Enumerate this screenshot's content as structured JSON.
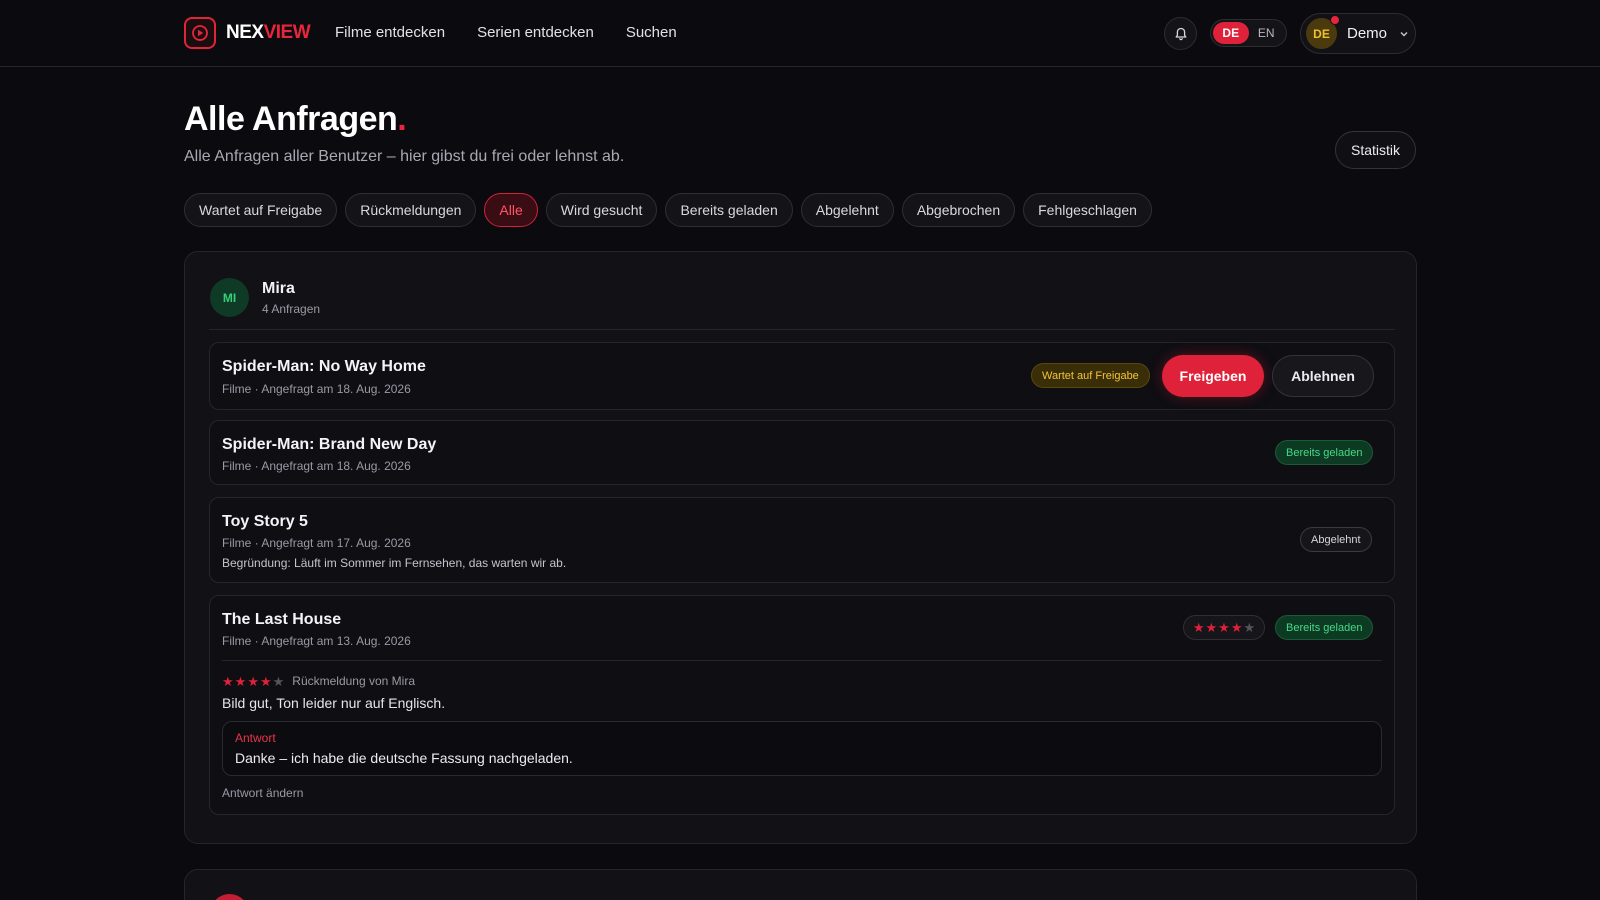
{
  "header": {
    "logo_a": "NEX",
    "logo_b": "VIEW",
    "nav": [
      "Filme entdecken",
      "Serien entdecken",
      "Suchen"
    ],
    "lang_active": "DE",
    "lang_other": "EN",
    "user_initials": "DE",
    "user_name": "Demo"
  },
  "page": {
    "title": "Alle Anfragen",
    "title_dot": ".",
    "subtitle": "Alle Anfragen aller Benutzer – hier gibst du frei oder lehnst ab.",
    "stats_button": "Statistik"
  },
  "filters": [
    "Wartet auf Freigabe",
    "Rückmeldungen",
    "Alle",
    "Wird gesucht",
    "Bereits geladen",
    "Abgelehnt",
    "Abgebrochen",
    "Fehlgeschlagen"
  ],
  "active_filter": "Alle",
  "group": {
    "initials": "MI",
    "name": "Mira",
    "count": "4 Anfragen",
    "requests": [
      {
        "title": "Spider-Man: No Way Home",
        "meta": "Filme · Angefragt am 18. Aug. 2026",
        "status": "Wartet auf Freigabe",
        "approve": "Freigeben",
        "reject": "Ablehnen"
      },
      {
        "title": "Spider-Man: Brand New Day",
        "meta": "Filme · Angefragt am 18. Aug. 2026",
        "status": "Bereits geladen"
      },
      {
        "title": "Toy Story 5",
        "meta": "Filme · Angefragt am 17. Aug. 2026",
        "reason": "Begründung: Läuft im Sommer im Fernsehen, das warten wir ab.",
        "status": "Abgelehnt"
      },
      {
        "title": "The Last House",
        "meta": "Filme · Angefragt am 13. Aug. 2026",
        "status": "Bereits geladen",
        "rating": 4,
        "rating_max": 5,
        "feedback_from": "Rückmeldung von Mira",
        "feedback_text": "Bild gut, Ton leider nur auf Englisch.",
        "answer_label": "Antwort",
        "answer_text": "Danke – ich habe die deutsche Fassung nachgeladen.",
        "edit_answer": "Antwort ändern"
      }
    ]
  },
  "colors": {
    "accent": "#e0213a",
    "background": "#0b0b0f",
    "success": "#46d98a",
    "warning": "#f2c33a"
  },
  "icons": [
    "play-logo-icon",
    "bell-icon",
    "chevron-down-icon",
    "star-icon"
  ]
}
